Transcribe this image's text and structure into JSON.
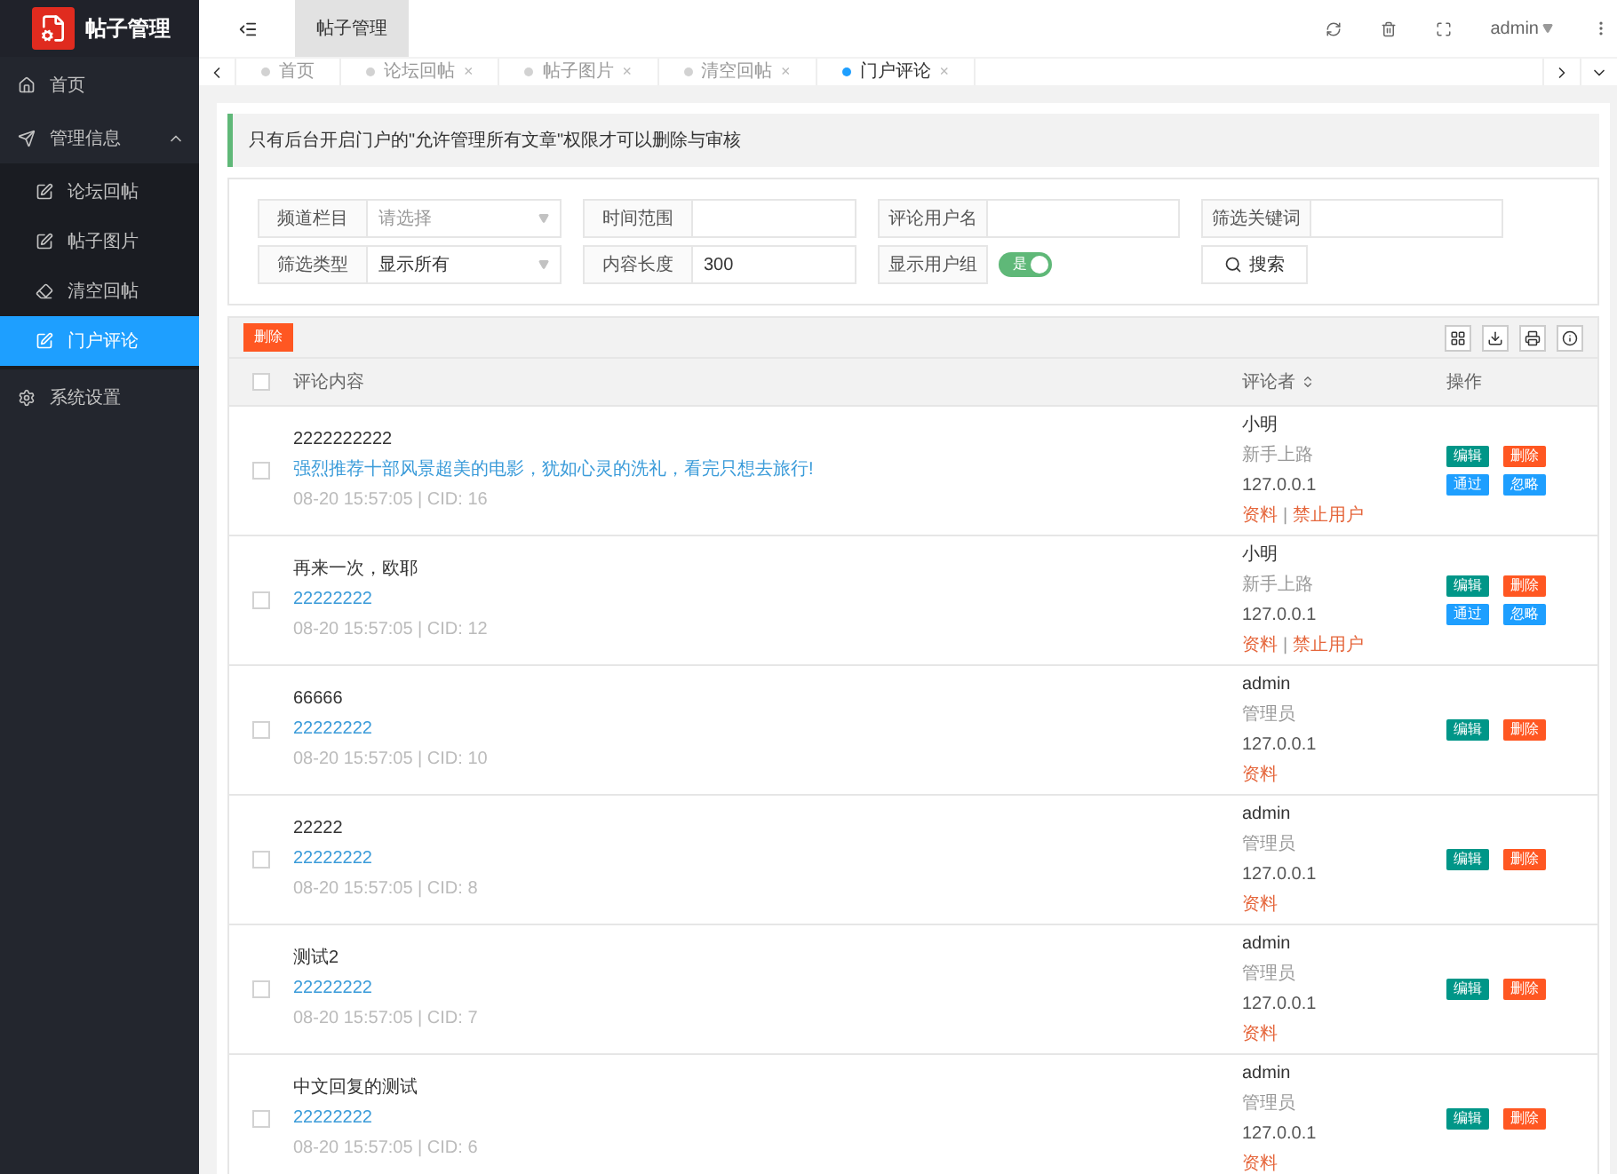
{
  "app": {
    "title": "帖子管理"
  },
  "header": {
    "breadcrumb": "帖子管理",
    "user": "admin"
  },
  "sidebar": {
    "items": [
      {
        "label": "首页",
        "selected": false
      },
      {
        "label": "管理信息",
        "selected": false,
        "expanded": true,
        "children": [
          {
            "label": "论坛回帖",
            "selected": false
          },
          {
            "label": "帖子图片",
            "selected": false
          },
          {
            "label": "清空回帖",
            "selected": false
          },
          {
            "label": "门户评论",
            "selected": true
          }
        ]
      },
      {
        "label": "系统设置",
        "selected": false
      }
    ]
  },
  "tabs": [
    {
      "label": "首页",
      "closable": false,
      "selected": false
    },
    {
      "label": "论坛回帖",
      "closable": true,
      "selected": false
    },
    {
      "label": "帖子图片",
      "closable": true,
      "selected": false
    },
    {
      "label": "清空回帖",
      "closable": true,
      "selected": false
    },
    {
      "label": "门户评论",
      "closable": true,
      "selected": true
    }
  ],
  "close_glyph": "×",
  "notice": "只有后台开启门户的\"允许管理所有文章\"权限才可以删除与审核",
  "filters": [
    {
      "kind": "select",
      "label": "频道栏目",
      "placeholder": "请选择"
    },
    {
      "kind": "text",
      "label": "时间范围"
    },
    {
      "kind": "text",
      "label": "评论用户名"
    },
    {
      "kind": "text",
      "label": "筛选关键词"
    },
    {
      "kind": "select",
      "label": "筛选类型",
      "value": "显示所有"
    },
    {
      "kind": "text",
      "label": "内容长度",
      "value": "300"
    },
    {
      "kind": "switch",
      "label": "显示用户组",
      "on": true,
      "switch_text": "是"
    },
    {
      "kind": "button",
      "label": "搜索"
    }
  ],
  "toolbar": {
    "delete_button": "删除"
  },
  "table": {
    "columns": [
      "评论内容",
      "评论者",
      "操作"
    ],
    "select_all_checked": false,
    "link_separator": "|",
    "rows": [
      {
        "checked": false,
        "title": "2222222222",
        "link": "强烈推荐十部风景超美的电影，犹如心灵的洗礼，看完只想去旅行!",
        "meta": "08-20 15:57:05 | CID: 16",
        "author": "小明",
        "group": "新手上路",
        "ip": "127.0.0.1",
        "links": [
          "资料",
          "禁止用户"
        ],
        "actions": [
          {
            "kind": "edit",
            "label": "编辑"
          },
          {
            "kind": "delete",
            "label": "删除"
          },
          {
            "kind": "pass",
            "label": "通过"
          },
          {
            "kind": "ignore",
            "label": "忽略"
          }
        ]
      },
      {
        "checked": false,
        "title": "再来一次，欧耶",
        "link": "22222222",
        "meta": "08-20 15:57:05 | CID: 12",
        "author": "小明",
        "group": "新手上路",
        "ip": "127.0.0.1",
        "links": [
          "资料",
          "禁止用户"
        ],
        "actions": [
          {
            "kind": "edit",
            "label": "编辑"
          },
          {
            "kind": "delete",
            "label": "删除"
          },
          {
            "kind": "pass",
            "label": "通过"
          },
          {
            "kind": "ignore",
            "label": "忽略"
          }
        ]
      },
      {
        "checked": false,
        "title": "66666",
        "link": "22222222",
        "meta": "08-20 15:57:05 | CID: 10",
        "author": "admin",
        "group": "管理员",
        "ip": "127.0.0.1",
        "links": [
          "资料"
        ],
        "actions": [
          {
            "kind": "edit",
            "label": "编辑"
          },
          {
            "kind": "delete",
            "label": "删除"
          }
        ]
      },
      {
        "checked": false,
        "title": "22222",
        "link": "22222222",
        "meta": "08-20 15:57:05 | CID: 8",
        "author": "admin",
        "group": "管理员",
        "ip": "127.0.0.1",
        "links": [
          "资料"
        ],
        "actions": [
          {
            "kind": "edit",
            "label": "编辑"
          },
          {
            "kind": "delete",
            "label": "删除"
          }
        ]
      },
      {
        "checked": false,
        "title": "测试2",
        "link": "22222222",
        "meta": "08-20 15:57:05 | CID: 7",
        "author": "admin",
        "group": "管理员",
        "ip": "127.0.0.1",
        "links": [
          "资料"
        ],
        "actions": [
          {
            "kind": "edit",
            "label": "编辑"
          },
          {
            "kind": "delete",
            "label": "删除"
          }
        ]
      },
      {
        "checked": false,
        "title": "中文回复的测试",
        "link": "22222222",
        "meta": "08-20 15:57:05 | CID: 6",
        "author": "admin",
        "group": "管理员",
        "ip": "127.0.0.1",
        "links": [
          "资料"
        ],
        "actions": [
          {
            "kind": "edit",
            "label": "编辑"
          },
          {
            "kind": "delete",
            "label": "删除"
          }
        ]
      }
    ]
  }
}
